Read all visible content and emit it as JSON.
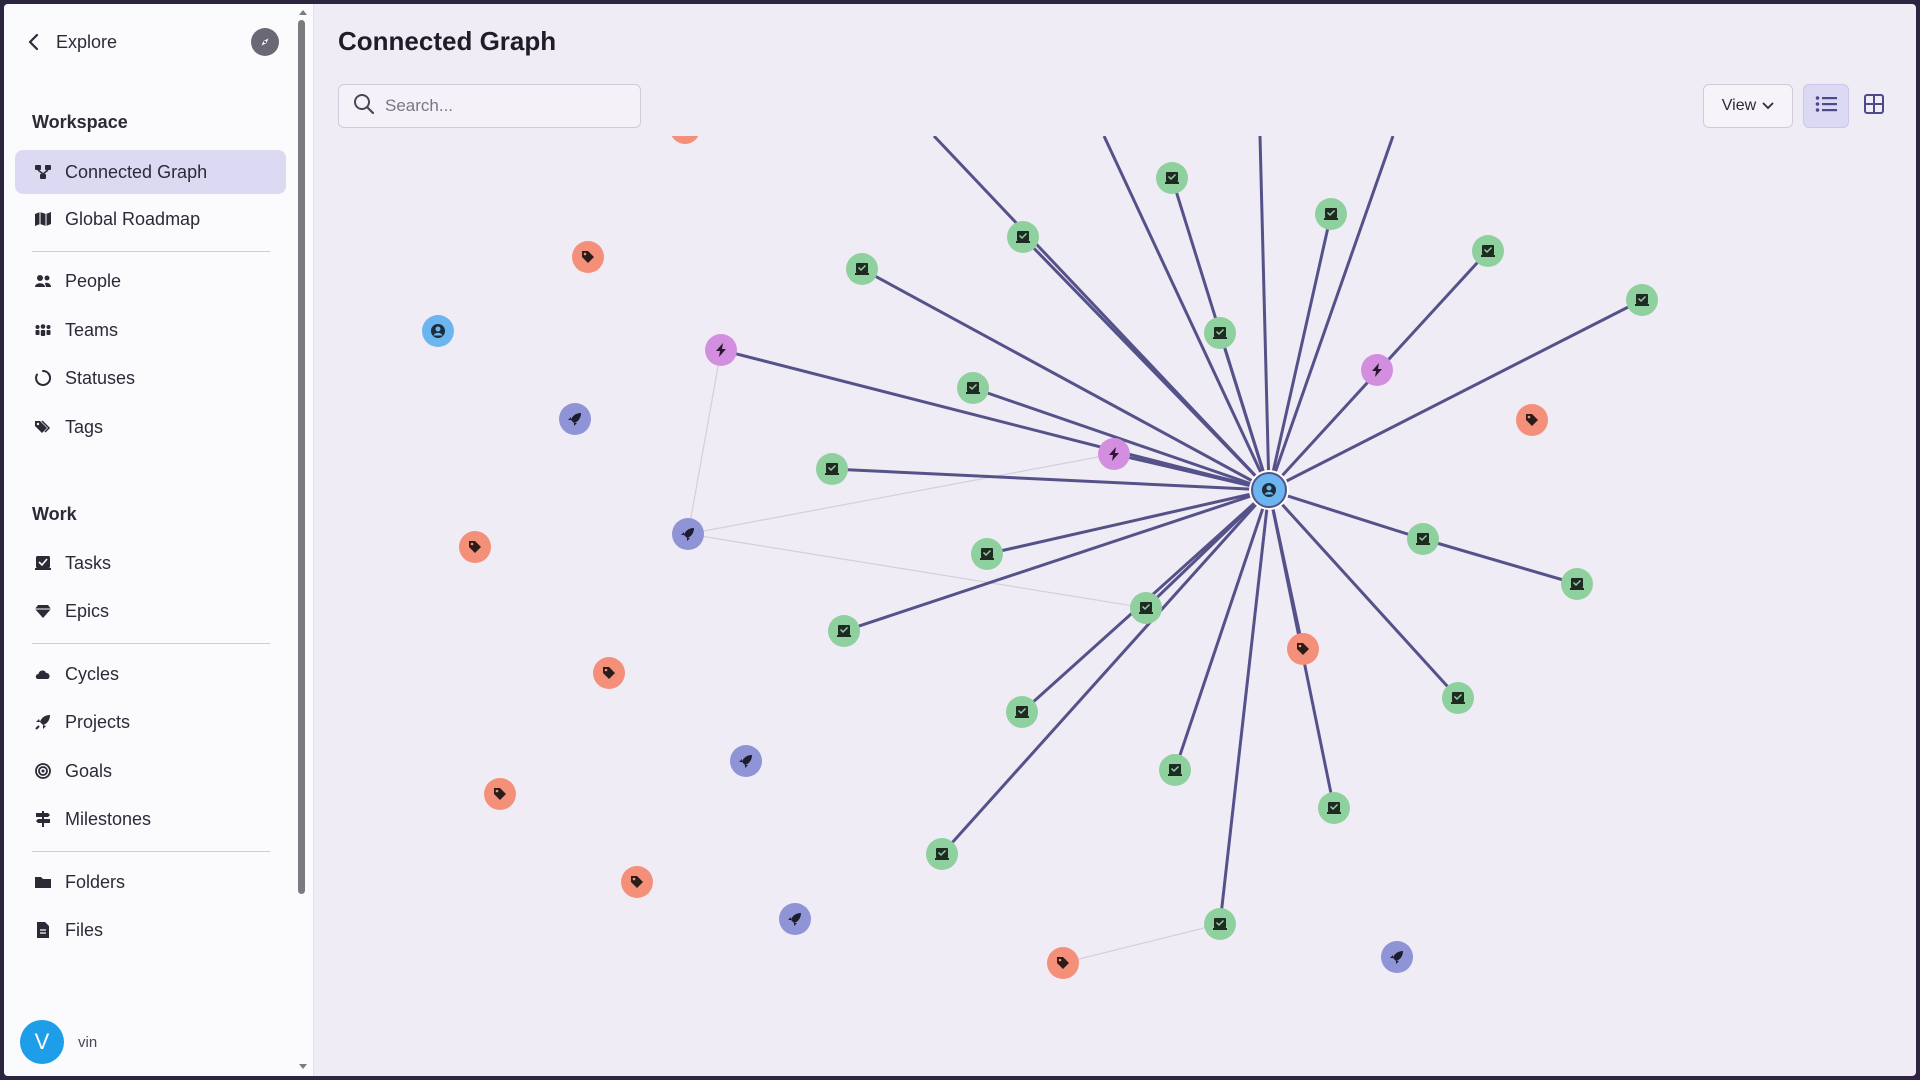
{
  "sidebar": {
    "header": {
      "title": "Explore"
    },
    "sections": {
      "workspace": "Workspace",
      "work": "Work"
    },
    "items": [
      {
        "label": "Connected Graph",
        "icon": "graph-icon",
        "active": true
      },
      {
        "label": "Global Roadmap",
        "icon": "map-icon"
      },
      {
        "label": "People",
        "icon": "people-icon"
      },
      {
        "label": "Teams",
        "icon": "teams-icon"
      },
      {
        "label": "Statuses",
        "icon": "status-circle-icon"
      },
      {
        "label": "Tags",
        "icon": "tags-icon"
      },
      {
        "label": "Tasks",
        "icon": "task-icon"
      },
      {
        "label": "Epics",
        "icon": "gem-icon"
      },
      {
        "label": "Cycles",
        "icon": "cloud-icon"
      },
      {
        "label": "Projects",
        "icon": "rocket-icon"
      },
      {
        "label": "Goals",
        "icon": "target-icon"
      },
      {
        "label": "Milestones",
        "icon": "signpost-icon"
      },
      {
        "label": "Folders",
        "icon": "folder-icon"
      },
      {
        "label": "Files",
        "icon": "file-icon"
      }
    ],
    "user": {
      "initial": "V",
      "name": "vin"
    }
  },
  "main": {
    "title": "Connected Graph",
    "search": {
      "placeholder": "Search...",
      "value": ""
    },
    "view_button": "View"
  },
  "colors": {
    "task": "#8fd19e",
    "tag": "#f4907a",
    "project": "#8e94d6",
    "epic": "#d48ee0",
    "person": "#6cb6f0",
    "edge": "#55528a",
    "active_nav": "#dcd9f3"
  }
}
